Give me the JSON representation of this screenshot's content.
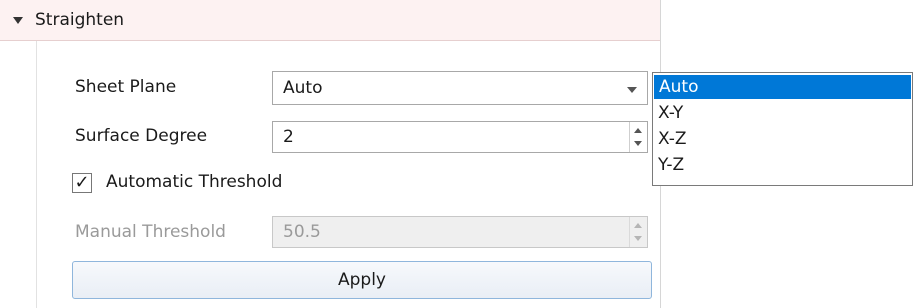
{
  "section": {
    "title": "Straighten"
  },
  "fields": {
    "sheet_plane": {
      "label": "Sheet Plane",
      "value": "Auto"
    },
    "surface_degree": {
      "label": "Surface Degree",
      "value": "2"
    },
    "automatic_threshold": {
      "label": "Automatic Threshold",
      "checked": true,
      "mark": "✓"
    },
    "manual_threshold": {
      "label": "Manual Threshold",
      "value": "50.5",
      "disabled": true
    }
  },
  "apply_button": {
    "label": "Apply"
  },
  "dropdown": {
    "options": [
      "Auto",
      "X-Y",
      "X-Z",
      "Y-Z"
    ],
    "selected": "Auto"
  },
  "colors": {
    "selection": "#0078d7",
    "header_bg": "#fdf2f2"
  }
}
